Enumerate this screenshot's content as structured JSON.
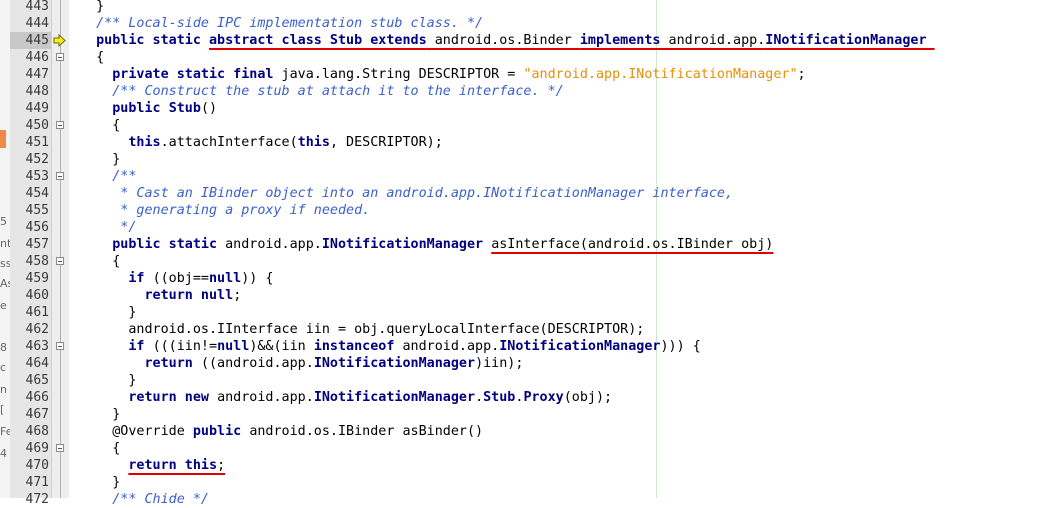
{
  "editor": {
    "current_line": "445",
    "left_strip_fragments": [
      "5",
      "nt",
      "ss",
      "As",
      "e",
      "8",
      "c",
      "n",
      "[",
      "Fe",
      "4"
    ]
  },
  "lines": [
    {
      "n": "443",
      "fold": false,
      "tokens": [
        {
          "t": "  }",
          "c": ""
        }
      ]
    },
    {
      "n": "444",
      "fold": false,
      "tokens": [
        {
          "t": "  /** Local-side IPC implementation stub class. */",
          "c": "c"
        }
      ]
    },
    {
      "n": "445",
      "fold": false,
      "arrow": true,
      "tokens": [
        {
          "t": "  public static ",
          "c": "k"
        },
        {
          "t": "abstract class Stub extends",
          "c": "k u"
        },
        {
          "t": " android.os.Binder ",
          "c": "u"
        },
        {
          "t": "implements",
          "c": "k u"
        },
        {
          "t": " android.app.",
          "c": "u"
        },
        {
          "t": "INotificationManager",
          "c": "t u"
        },
        {
          "t": " ",
          "c": "u"
        }
      ]
    },
    {
      "n": "446",
      "fold": true,
      "tokens": [
        {
          "t": "  {",
          "c": ""
        }
      ]
    },
    {
      "n": "447",
      "fold": false,
      "tokens": [
        {
          "t": "    private static final ",
          "c": "k"
        },
        {
          "t": "java.lang.String DESCRIPTOR = ",
          "c": ""
        },
        {
          "t": "\"android.app.INotificationManager\"",
          "c": "s"
        },
        {
          "t": ";",
          "c": ""
        }
      ]
    },
    {
      "n": "448",
      "fold": false,
      "tokens": [
        {
          "t": "    /** Construct the stub at attach it to the interface. */",
          "c": "c"
        }
      ]
    },
    {
      "n": "449",
      "fold": false,
      "tokens": [
        {
          "t": "    public ",
          "c": "k"
        },
        {
          "t": "Stub",
          "c": "t"
        },
        {
          "t": "()",
          "c": ""
        }
      ]
    },
    {
      "n": "450",
      "fold": true,
      "tokens": [
        {
          "t": "    {",
          "c": ""
        }
      ]
    },
    {
      "n": "451",
      "fold": false,
      "tokens": [
        {
          "t": "      ",
          "c": ""
        },
        {
          "t": "this",
          "c": "k"
        },
        {
          "t": ".attachInterface(",
          "c": ""
        },
        {
          "t": "this",
          "c": "k"
        },
        {
          "t": ", DESCRIPTOR);",
          "c": ""
        }
      ]
    },
    {
      "n": "452",
      "fold": false,
      "tokens": [
        {
          "t": "    }",
          "c": ""
        }
      ]
    },
    {
      "n": "453",
      "fold": true,
      "tokens": [
        {
          "t": "    /**",
          "c": "c"
        }
      ]
    },
    {
      "n": "454",
      "fold": false,
      "tokens": [
        {
          "t": "     * Cast an IBinder object into an android.app.INotificationManager interface,",
          "c": "c"
        }
      ]
    },
    {
      "n": "455",
      "fold": false,
      "tokens": [
        {
          "t": "     * generating a proxy if needed.",
          "c": "c"
        }
      ]
    },
    {
      "n": "456",
      "fold": false,
      "tokens": [
        {
          "t": "     */",
          "c": "c"
        }
      ]
    },
    {
      "n": "457",
      "fold": false,
      "tokens": [
        {
          "t": "    public static ",
          "c": "k"
        },
        {
          "t": "android.app.",
          "c": ""
        },
        {
          "t": "INotificationManager",
          "c": "t"
        },
        {
          "t": " ",
          "c": ""
        },
        {
          "t": "asInterface(android.os.IBinder obj)",
          "c": "u"
        }
      ]
    },
    {
      "n": "458",
      "fold": true,
      "tokens": [
        {
          "t": "    {",
          "c": ""
        }
      ]
    },
    {
      "n": "459",
      "fold": false,
      "tokens": [
        {
          "t": "      if ",
          "c": "k"
        },
        {
          "t": "((obj==",
          "c": ""
        },
        {
          "t": "null",
          "c": "k"
        },
        {
          "t": ")) {",
          "c": ""
        }
      ]
    },
    {
      "n": "460",
      "fold": false,
      "tokens": [
        {
          "t": "        return null",
          "c": "k"
        },
        {
          "t": ";",
          "c": ""
        }
      ]
    },
    {
      "n": "461",
      "fold": false,
      "tokens": [
        {
          "t": "      }",
          "c": ""
        }
      ]
    },
    {
      "n": "462",
      "fold": false,
      "tokens": [
        {
          "t": "      android.os.IInterface iin = obj.queryLocalInterface(DESCRIPTOR);",
          "c": ""
        }
      ]
    },
    {
      "n": "463",
      "fold": true,
      "tokens": [
        {
          "t": "      if ",
          "c": "k"
        },
        {
          "t": "(((iin!=",
          "c": ""
        },
        {
          "t": "null",
          "c": "k"
        },
        {
          "t": ")&&(iin ",
          "c": ""
        },
        {
          "t": "instanceof",
          "c": "k"
        },
        {
          "t": " android.app.",
          "c": ""
        },
        {
          "t": "INotificationManager",
          "c": "t"
        },
        {
          "t": "))) {",
          "c": ""
        }
      ]
    },
    {
      "n": "464",
      "fold": false,
      "tokens": [
        {
          "t": "        return ",
          "c": "k"
        },
        {
          "t": "((android.app.",
          "c": ""
        },
        {
          "t": "INotificationManager",
          "c": "t"
        },
        {
          "t": ")iin);",
          "c": ""
        }
      ]
    },
    {
      "n": "465",
      "fold": false,
      "tokens": [
        {
          "t": "      }",
          "c": ""
        }
      ]
    },
    {
      "n": "466",
      "fold": false,
      "tokens": [
        {
          "t": "      return new ",
          "c": "k"
        },
        {
          "t": "android.app.",
          "c": ""
        },
        {
          "t": "INotificationManager",
          "c": "t"
        },
        {
          "t": ".",
          "c": ""
        },
        {
          "t": "Stub",
          "c": "t"
        },
        {
          "t": ".",
          "c": ""
        },
        {
          "t": "Proxy",
          "c": "t"
        },
        {
          "t": "(obj);",
          "c": ""
        }
      ]
    },
    {
      "n": "467",
      "fold": false,
      "tokens": [
        {
          "t": "    }",
          "c": ""
        }
      ]
    },
    {
      "n": "468",
      "fold": false,
      "tokens": [
        {
          "t": "    @Override ",
          "c": ""
        },
        {
          "t": "public ",
          "c": "k"
        },
        {
          "t": "android.os.IBinder asBinder()",
          "c": ""
        }
      ]
    },
    {
      "n": "469",
      "fold": true,
      "tokens": [
        {
          "t": "    {",
          "c": ""
        }
      ]
    },
    {
      "n": "470",
      "fold": false,
      "tokens": [
        {
          "t": "      ",
          "c": ""
        },
        {
          "t": "return this",
          "c": "k u"
        },
        {
          "t": ";",
          "c": "u"
        }
      ]
    },
    {
      "n": "471",
      "fold": false,
      "tokens": [
        {
          "t": "    }",
          "c": ""
        }
      ]
    },
    {
      "n": "472",
      "fold": false,
      "tokens": [
        {
          "t": "    /** Chide */",
          "c": "c"
        }
      ]
    }
  ]
}
